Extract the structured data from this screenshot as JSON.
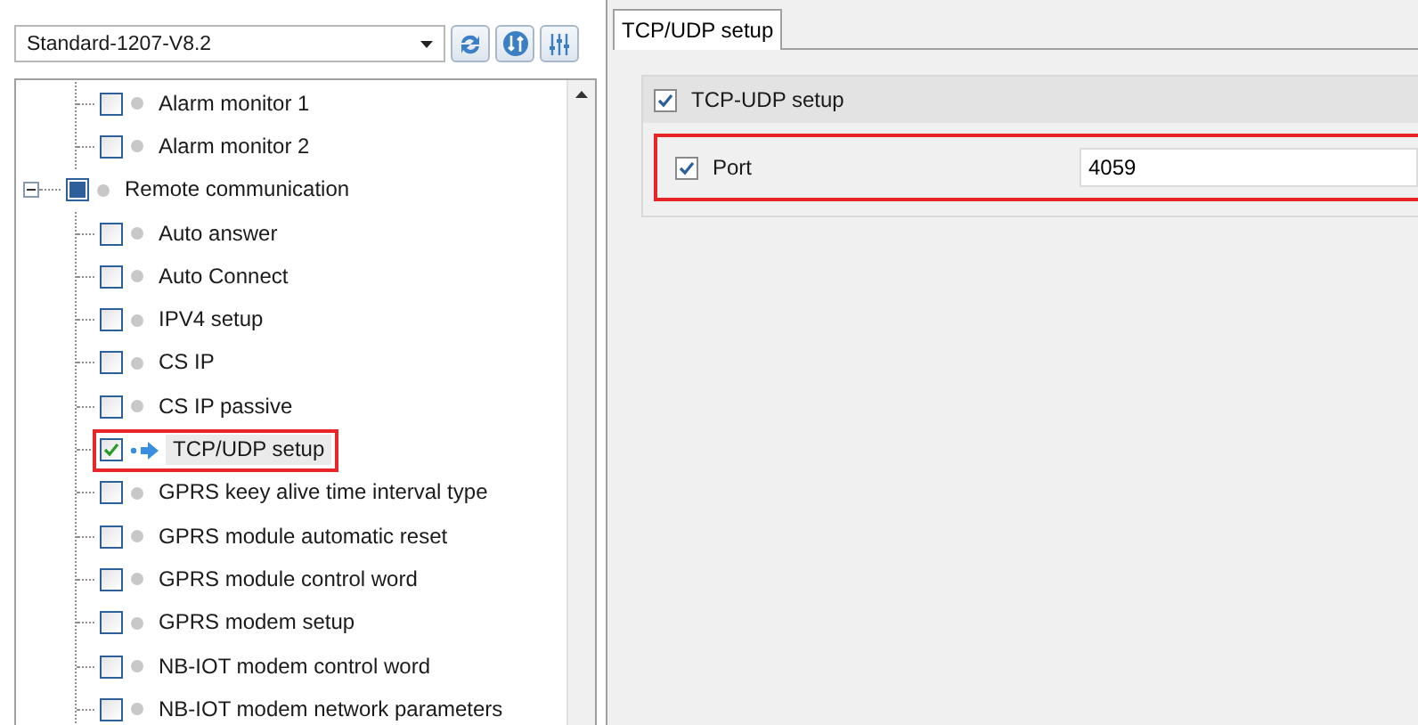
{
  "profile_select": {
    "value": "Standard-1207-V8.2"
  },
  "tree": {
    "items": [
      {
        "children": [
          {
            "label": "Alarm monitor 1",
            "checked": false,
            "partial": false,
            "selected": false,
            "highlighted": false
          },
          {
            "label": "Alarm monitor 2",
            "checked": false,
            "partial": false,
            "selected": false,
            "highlighted": false
          }
        ]
      },
      {
        "label": "Remote communication",
        "checked": false,
        "partial": true,
        "expanded": true,
        "selected": false,
        "highlighted": false,
        "children": [
          {
            "label": "Auto answer",
            "checked": false,
            "partial": false,
            "selected": false,
            "highlighted": false
          },
          {
            "label": "Auto Connect",
            "checked": false,
            "partial": false,
            "selected": false,
            "highlighted": false
          },
          {
            "label": "IPV4 setup",
            "checked": false,
            "partial": false,
            "selected": false,
            "highlighted": false
          },
          {
            "label": "CS IP",
            "checked": false,
            "partial": false,
            "selected": false,
            "highlighted": false
          },
          {
            "label": "CS IP passive",
            "checked": false,
            "partial": false,
            "selected": false,
            "highlighted": false
          },
          {
            "label": "TCP/UDP setup",
            "checked": true,
            "partial": false,
            "selected": true,
            "highlighted": true
          },
          {
            "label": "GPRS keey alive time interval type",
            "checked": false,
            "partial": false,
            "selected": false,
            "highlighted": false
          },
          {
            "label": "GPRS module automatic reset",
            "checked": false,
            "partial": false,
            "selected": false,
            "highlighted": false
          },
          {
            "label": "GPRS module control word",
            "checked": false,
            "partial": false,
            "selected": false,
            "highlighted": false
          },
          {
            "label": "GPRS modem setup",
            "checked": false,
            "partial": false,
            "selected": false,
            "highlighted": false
          },
          {
            "label": "NB-IOT modem control word",
            "checked": false,
            "partial": false,
            "selected": false,
            "highlighted": false
          },
          {
            "label": "NB-IOT modem network parameters",
            "checked": false,
            "partial": false,
            "selected": false,
            "highlighted": false
          }
        ]
      }
    ]
  },
  "tabs": [
    {
      "label": "TCP/UDP setup",
      "selected": true
    }
  ],
  "group": {
    "title": "TCP-UDP setup",
    "checked": true,
    "fields": [
      {
        "label": "Port",
        "checked": true,
        "value": "4059",
        "highlighted": true
      }
    ]
  }
}
